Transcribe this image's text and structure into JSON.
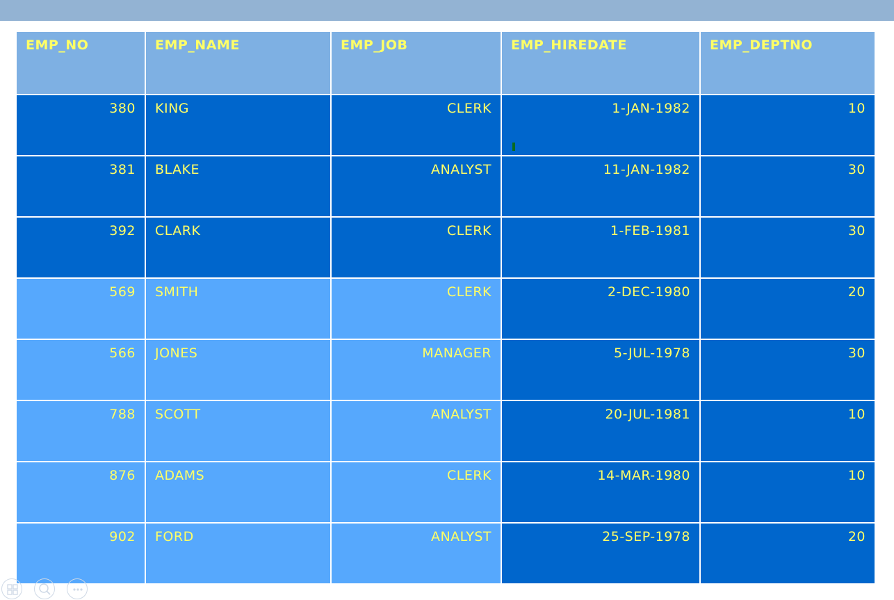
{
  "table": {
    "headers": [
      "EMP_NO",
      "EMP_NAME",
      "EMP_JOB",
      "EMP_HIREDATE",
      "EMP_DEPTNO"
    ],
    "rows": [
      {
        "emp_no": "380",
        "emp_name": "KING",
        "emp_job": "CLERK",
        "emp_hiredate": "1-JAN-1982",
        "emp_deptno": "10"
      },
      {
        "emp_no": "381",
        "emp_name": "BLAKE",
        "emp_job": "ANALYST",
        "emp_hiredate": "11-JAN-1982",
        "emp_deptno": "30"
      },
      {
        "emp_no": "392",
        "emp_name": "CLARK",
        "emp_job": "CLERK",
        "emp_hiredate": "1-FEB-1981",
        "emp_deptno": "30"
      },
      {
        "emp_no": "569",
        "emp_name": "SMITH",
        "emp_job": "CLERK",
        "emp_hiredate": "2-DEC-1980",
        "emp_deptno": "20"
      },
      {
        "emp_no": "566",
        "emp_name": "JONES",
        "emp_job": "MANAGER",
        "emp_hiredate": "5-JUL-1978",
        "emp_deptno": "30"
      },
      {
        "emp_no": "788",
        "emp_name": "SCOTT",
        "emp_job": "ANALYST",
        "emp_hiredate": "20-JUL-1981",
        "emp_deptno": "10"
      },
      {
        "emp_no": "876",
        "emp_name": "ADAMS",
        "emp_job": "CLERK",
        "emp_hiredate": "14-MAR-1980",
        "emp_deptno": "10"
      },
      {
        "emp_no": "902",
        "emp_name": "FORD",
        "emp_job": "ANALYST",
        "emp_hiredate": "25-SEP-1978",
        "emp_deptno": "20"
      }
    ]
  },
  "colors": {
    "header_bg": "#7eb0e3",
    "highlight_dark": "#0066cc",
    "light": "#56a8fd",
    "text": "#ffff66",
    "top_bar": "#93b3d3"
  },
  "controls": {
    "icons": [
      "slides-icon",
      "zoom-icon",
      "more-options-icon"
    ]
  }
}
